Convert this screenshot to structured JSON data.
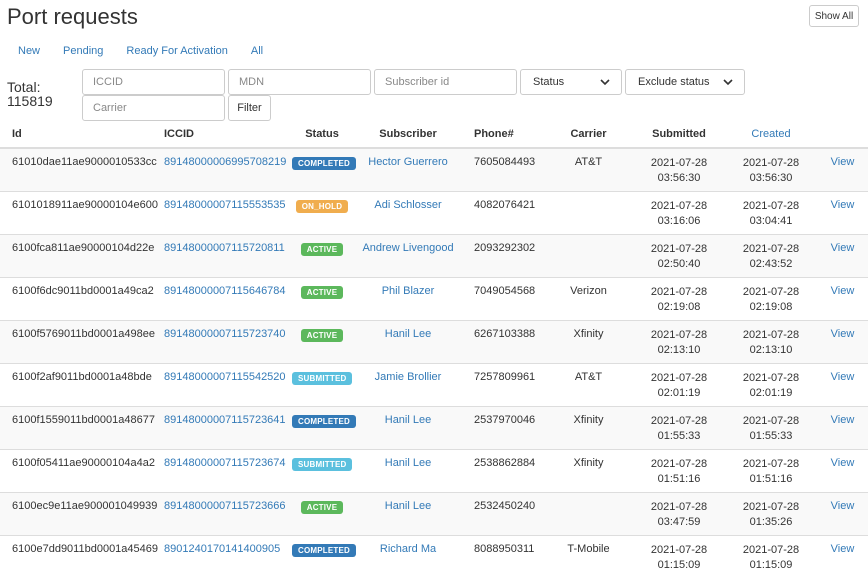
{
  "page": {
    "title": "Port requests",
    "show_all_label": "Show All"
  },
  "tabs": [
    {
      "label": "New"
    },
    {
      "label": "Pending"
    },
    {
      "label": "Ready For Activation"
    },
    {
      "label": "All"
    }
  ],
  "total": {
    "label": "Total:",
    "value": "115819"
  },
  "filters": {
    "iccid_placeholder": "ICCID",
    "mdn_placeholder": "MDN",
    "subscriber_placeholder": "Subscriber id",
    "carrier_placeholder": "Carrier",
    "status_label": "Status",
    "exclude_status_label": "Exclude status",
    "filter_button": "Filter"
  },
  "table": {
    "headers": {
      "id": "Id",
      "iccid": "ICCID",
      "status": "Status",
      "subscriber": "Subscriber",
      "phone": "Phone#",
      "carrier": "Carrier",
      "submitted": "Submitted",
      "created": "Created"
    },
    "view_label": "View",
    "rows": [
      {
        "id": "61010dae11ae9000010533cc",
        "iccid": "89148000006995708219",
        "status": "COMPLETED",
        "status_color": "#337ab7",
        "subscriber": "Hector Guerrero",
        "phone": "7605084493",
        "carrier": "AT&T",
        "submitted_date": "2021-07-28",
        "submitted_time": "03:56:30",
        "created_date": "2021-07-28",
        "created_time": "03:56:30"
      },
      {
        "id": "6101018911ae90000104e600",
        "iccid": "89148000007115553535",
        "status": "ON_HOLD",
        "status_color": "#f0ad4e",
        "subscriber": "Adi Schlosser",
        "phone": "4082076421",
        "carrier": "",
        "submitted_date": "2021-07-28",
        "submitted_time": "03:16:06",
        "created_date": "2021-07-28",
        "created_time": "03:04:41"
      },
      {
        "id": "6100fca811ae90000104d22e",
        "iccid": "89148000007115720811",
        "status": "ACTIVE",
        "status_color": "#5cb85c",
        "subscriber": "Andrew Livengood",
        "phone": "2093292302",
        "carrier": "",
        "submitted_date": "2021-07-28",
        "submitted_time": "02:50:40",
        "created_date": "2021-07-28",
        "created_time": "02:43:52"
      },
      {
        "id": "6100f6dc9011bd0001a49ca2",
        "iccid": "89148000007115646784",
        "status": "ACTIVE",
        "status_color": "#5cb85c",
        "subscriber": "Phil Blazer",
        "phone": "7049054568",
        "carrier": "Verizon",
        "submitted_date": "2021-07-28",
        "submitted_time": "02:19:08",
        "created_date": "2021-07-28",
        "created_time": "02:19:08"
      },
      {
        "id": "6100f5769011bd0001a498ee",
        "iccid": "89148000007115723740",
        "status": "ACTIVE",
        "status_color": "#5cb85c",
        "subscriber": "Hanil Lee",
        "phone": "6267103388",
        "carrier": "Xfinity",
        "submitted_date": "2021-07-28",
        "submitted_time": "02:13:10",
        "created_date": "2021-07-28",
        "created_time": "02:13:10"
      },
      {
        "id": "6100f2af9011bd0001a48bde",
        "iccid": "89148000007115542520",
        "status": "SUBMITTED",
        "status_color": "#5bc0de",
        "subscriber": "Jamie Brollier",
        "phone": "7257809961",
        "carrier": "AT&T",
        "submitted_date": "2021-07-28",
        "submitted_time": "02:01:19",
        "created_date": "2021-07-28",
        "created_time": "02:01:19"
      },
      {
        "id": "6100f1559011bd0001a48677",
        "iccid": "89148000007115723641",
        "status": "COMPLETED",
        "status_color": "#337ab7",
        "subscriber": "Hanil Lee",
        "phone": "2537970046",
        "carrier": "Xfinity",
        "submitted_date": "2021-07-28",
        "submitted_time": "01:55:33",
        "created_date": "2021-07-28",
        "created_time": "01:55:33"
      },
      {
        "id": "6100f05411ae90000104a4a2",
        "iccid": "89148000007115723674",
        "status": "SUBMITTED",
        "status_color": "#5bc0de",
        "subscriber": "Hanil Lee",
        "phone": "2538862884",
        "carrier": "Xfinity",
        "submitted_date": "2021-07-28",
        "submitted_time": "01:51:16",
        "created_date": "2021-07-28",
        "created_time": "01:51:16"
      },
      {
        "id": "6100ec9e11ae900001049939",
        "iccid": "89148000007115723666",
        "status": "ACTIVE",
        "status_color": "#5cb85c",
        "subscriber": "Hanil Lee",
        "phone": "2532450240",
        "carrier": "",
        "submitted_date": "2021-07-28",
        "submitted_time": "03:47:59",
        "created_date": "2021-07-28",
        "created_time": "01:35:26"
      },
      {
        "id": "6100e7dd9011bd0001a45469",
        "iccid": "8901240170141400905",
        "status": "COMPLETED",
        "status_color": "#337ab7",
        "subscriber": "Richard Ma",
        "phone": "8088950311",
        "carrier": "T-Mobile",
        "submitted_date": "2021-07-28",
        "submitted_time": "01:15:09",
        "created_date": "2021-07-28",
        "created_time": "01:15:09"
      }
    ]
  }
}
